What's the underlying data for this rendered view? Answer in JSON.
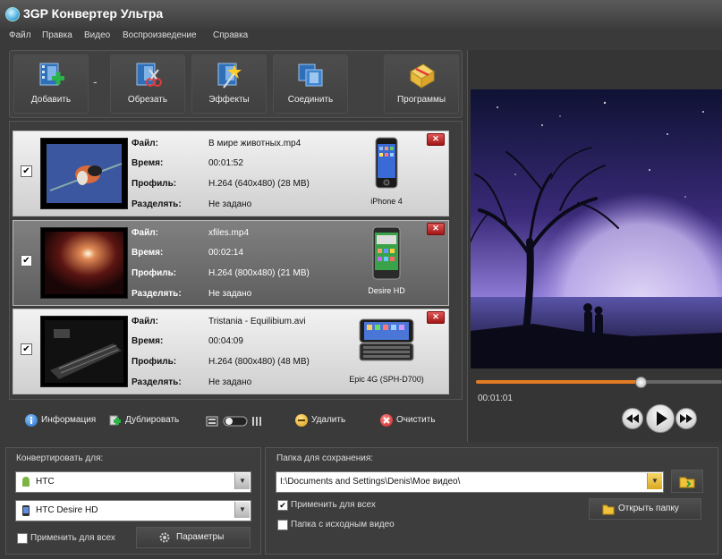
{
  "window": {
    "title": "3GP Конвертер Ультра"
  },
  "menu": [
    "Файл",
    "Правка",
    "Видео",
    "Воспроизведение",
    "Справка"
  ],
  "toolbar": {
    "add": "Добавить",
    "cut": "Обрезать",
    "effects": "Эффекты",
    "join": "Соединить",
    "programs": "Программы"
  },
  "meta_labels": {
    "file": "Файл:",
    "time": "Время:",
    "profile": "Профиль:",
    "split": "Разделять:"
  },
  "files": [
    {
      "name": "В мире животных.mp4",
      "time": "00:01:52",
      "profile": "H.264 (640x480) (28 MB)",
      "split": "Не задано",
      "device": "iPhone 4",
      "checked": true
    },
    {
      "name": "xfiles.mp4",
      "time": "00:02:14",
      "profile": "H.264 (800x480) (21 MB)",
      "split": "Не задано",
      "device": "Desire HD",
      "checked": true
    },
    {
      "name": "Tristania - Equilibium.avi",
      "time": "00:04:09",
      "profile": "H.264 (800x480) (48 MB)",
      "split": "Не задано",
      "device": "Epic 4G (SPH-D700)",
      "checked": true
    }
  ],
  "actions": {
    "info": "Информация",
    "duplicate": "Дублировать",
    "delete": "Удалить",
    "clear": "Очистить"
  },
  "player": {
    "time": "00:01:01",
    "progress": 0.67
  },
  "convert": {
    "title": "Конвертировать для:",
    "brand": "HTC",
    "model": "HTC Desire HD",
    "apply_all": "Применить для всех",
    "settings": "Параметры"
  },
  "output": {
    "title": "Папка для сохранения:",
    "path": "I:\\Documents and Settings\\Denis\\Мое видео\\",
    "apply_all": "Применить для всех",
    "source_folder": "Папка с исходным видео",
    "open_folder": "Открыть папку"
  },
  "colors": {
    "accent": "#e27b22",
    "close": "#c72020"
  }
}
